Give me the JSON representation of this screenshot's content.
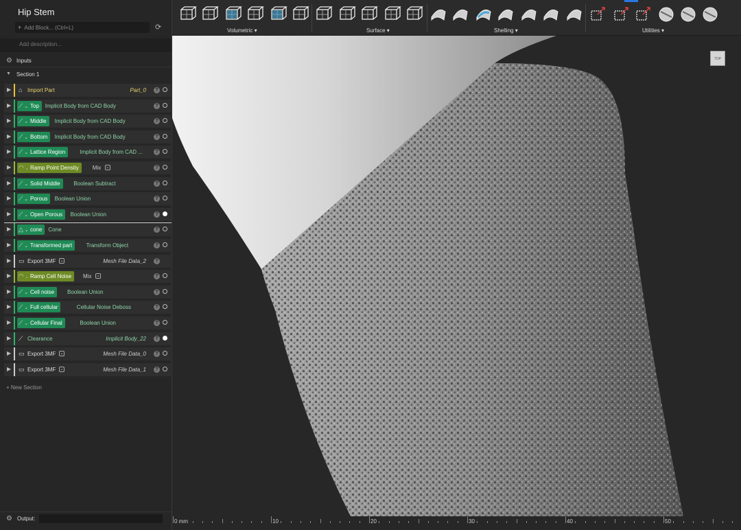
{
  "panel": {
    "title": "Hip Stem",
    "add_block": "Add Block... (Ctrl+L)",
    "description_placeholder": "Add description...",
    "inputs_label": "Inputs",
    "section_label": "Section 1",
    "new_section": "New Section",
    "output_label": "Output:"
  },
  "blocks": [
    {
      "name": "Import Part",
      "type": "",
      "output": "Part_0",
      "kind": "import",
      "color": "#e8c23b"
    },
    {
      "name": "Top",
      "type": "Implicit Body from CAD Body",
      "output": "",
      "kind": "implicit",
      "color": "#2db36a"
    },
    {
      "name": "Middle",
      "type": "Implicit Body from CAD Body",
      "output": "",
      "kind": "implicit",
      "color": "#2db36a"
    },
    {
      "name": "Bottom",
      "type": "Implicit Body from CAD Body",
      "output": "",
      "kind": "implicit",
      "color": "#2db36a"
    },
    {
      "name": "Lattice Region",
      "type": "Implicit Body from CAD ...",
      "output": "",
      "kind": "implicit",
      "color": "#2db36a"
    },
    {
      "name": "Ramp Point Density",
      "type": "Mix",
      "output": "",
      "kind": "ramp",
      "color": "#9ab83a"
    },
    {
      "name": "Solid Middle",
      "type": "Boolean Subtract",
      "output": "",
      "kind": "implicit",
      "color": "#2db36a"
    },
    {
      "name": "Porous",
      "type": "Boolean Union",
      "output": "",
      "kind": "implicit",
      "color": "#2db36a"
    },
    {
      "name": "Open Porous",
      "type": "Boolean Union",
      "output": "",
      "kind": "implicit",
      "color": "#2db36a",
      "active": true
    },
    {
      "name": "cone",
      "type": "Cone",
      "output": "",
      "kind": "cone",
      "color": "#2db36a"
    },
    {
      "name": "Transformed part",
      "type": "Transform Object",
      "output": "",
      "kind": "implicit",
      "color": "#2db36a"
    },
    {
      "name": "Export 3MF",
      "type": "",
      "output": "Mesh File Data_2",
      "kind": "export",
      "color": "#cccccc"
    },
    {
      "name": "Ramp Cell Noise",
      "type": "Mix",
      "output": "",
      "kind": "ramp",
      "color": "#9ab83a"
    },
    {
      "name": "Cell noise",
      "type": "Boolean Union",
      "output": "",
      "kind": "implicit",
      "color": "#2db36a"
    },
    {
      "name": "Full cellular",
      "type": "Cellular Noise Deboss",
      "output": "",
      "kind": "implicit",
      "color": "#2db36a"
    },
    {
      "name": "Cellular Final",
      "type": "Boolean Union",
      "output": "",
      "kind": "implicit",
      "color": "#2db36a"
    },
    {
      "name": "Clearance",
      "type": "",
      "output": "Implicit Body_22",
      "kind": "clearance",
      "color": "#2db36a",
      "active": true
    },
    {
      "name": "Export 3MF",
      "type": "",
      "output": "Mesh File Data_0",
      "kind": "export",
      "color": "#cccccc"
    },
    {
      "name": "Export 3MF",
      "type": "",
      "output": "Mesh File Data_1",
      "kind": "export",
      "color": "#cccccc"
    }
  ],
  "toolbar": {
    "groups": [
      {
        "label": "Volumetric"
      },
      {
        "label": "Surface"
      },
      {
        "label": "Shelling"
      },
      {
        "label": "Utilities"
      }
    ]
  },
  "viewport": {
    "navcube_label": "TOP",
    "ruler": {
      "unit": "mm",
      "labels": [
        "0 mm",
        "10",
        "20",
        "30",
        "40",
        "50"
      ]
    }
  }
}
